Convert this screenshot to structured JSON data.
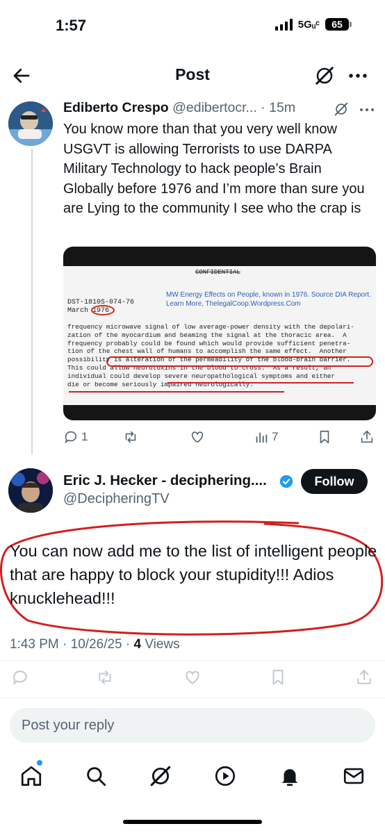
{
  "status_bar": {
    "time": "1:57",
    "network": "5Gᵤᶜ",
    "battery": "65"
  },
  "header": {
    "title": "Post",
    "back_icon": "arrow-left-icon",
    "grok_icon": "grok-icon",
    "more_icon": "more-icon"
  },
  "reply": {
    "author_name": "Ediberto Crespo",
    "handle": "@edibertocr...",
    "separator": "·",
    "time": "15m",
    "text": "You know more than that you very well know USGVT is allowing Terrorists to use DARPA Military Technology to hack people’s Brain Globally before 1976 and I’m more than sure you are Lying to the community I see who the crap is",
    "image": {
      "header": "CONFIDENTIAL",
      "ref_line1": "DST-1810S-074-76",
      "ref_line2": "March 1976",
      "note_line1": "MW Energy Effects on People, known in 1976.  Source DIA Report.",
      "note_line2": "Learn More, ThelegalCoop.Wordpress.Com",
      "body": "frequency microwave signal of low average-power density with the depolari-\nzation of the myocardium and beaming the signal at the thoracic area.  A\nfrequency probably could be found which would provide sufficient penetra-\ntion of the chest wall of humans to accomplish the same effect.  Another\npossibility is alteration of the permeability of the blood-brain barrier.\nThis could allow neurotoxins in the blood to cross.  As a result, an\nindividual could develop severe neuropathological symptoms and either\ndie or become seriously impaired neurologically."
    },
    "actions": {
      "replies": "1",
      "reposts": "",
      "likes": "",
      "views": "7"
    }
  },
  "post": {
    "author_name": "Eric J. Hecker - deciphering....",
    "handle": "@DecipheringTV",
    "follow_label": "Follow",
    "text": "You can now add me to the list of intelligent people that are happy to block your stupidity!!! Adios knucklehead!!!",
    "timestamp": "1:43 PM · 10/26/25 · ",
    "views_count": "4",
    "views_label": " Views"
  },
  "reply_box": {
    "placeholder": "Post your reply"
  },
  "tabbar": [
    "home-icon",
    "search-icon",
    "grok-icon",
    "video-icon",
    "notifications-icon",
    "messages-icon"
  ],
  "colors": {
    "accent": "#1d9bf0",
    "text": "#0f1419",
    "secondary": "#536471",
    "annotation_red": "#d21f1f"
  }
}
